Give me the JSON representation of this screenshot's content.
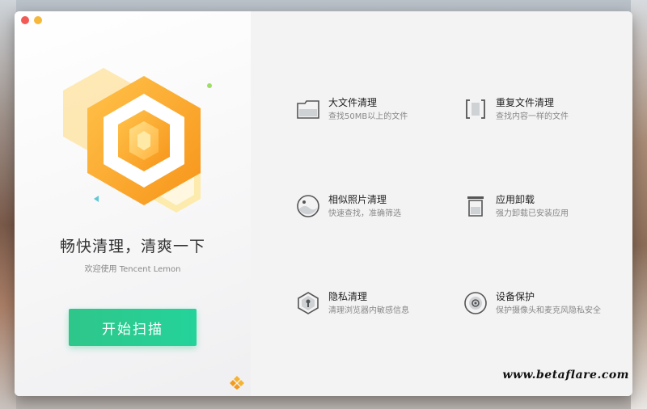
{
  "window": {
    "traffic_lights": [
      "close",
      "minimize"
    ]
  },
  "left": {
    "tagline": "畅快清理，清爽一下",
    "subtitle": "欢迎使用 Tencent Lemon",
    "start_button": "开始扫描",
    "colors": {
      "accent": "#29cc92",
      "hex_orange": "#f7a11a",
      "hex_yellow": "#ffd34d"
    }
  },
  "features": [
    {
      "title": "大文件清理",
      "desc": "查找50MB以上的文件",
      "icon": "folder-icon"
    },
    {
      "title": "重复文件清理",
      "desc": "查找内容一样的文件",
      "icon": "duplicate-icon"
    },
    {
      "title": "相似照片清理",
      "desc": "快速查找，准确筛选",
      "icon": "photo-icon"
    },
    {
      "title": "应用卸载",
      "desc": "强力卸载已安装应用",
      "icon": "trash-icon"
    },
    {
      "title": "隐私清理",
      "desc": "清理浏览器内敏感信息",
      "icon": "privacy-shield-icon"
    },
    {
      "title": "设备保护",
      "desc": "保护摄像头和麦克风隐私安全",
      "icon": "camera-protect-icon"
    }
  ],
  "watermark": "www.betaflare.com"
}
